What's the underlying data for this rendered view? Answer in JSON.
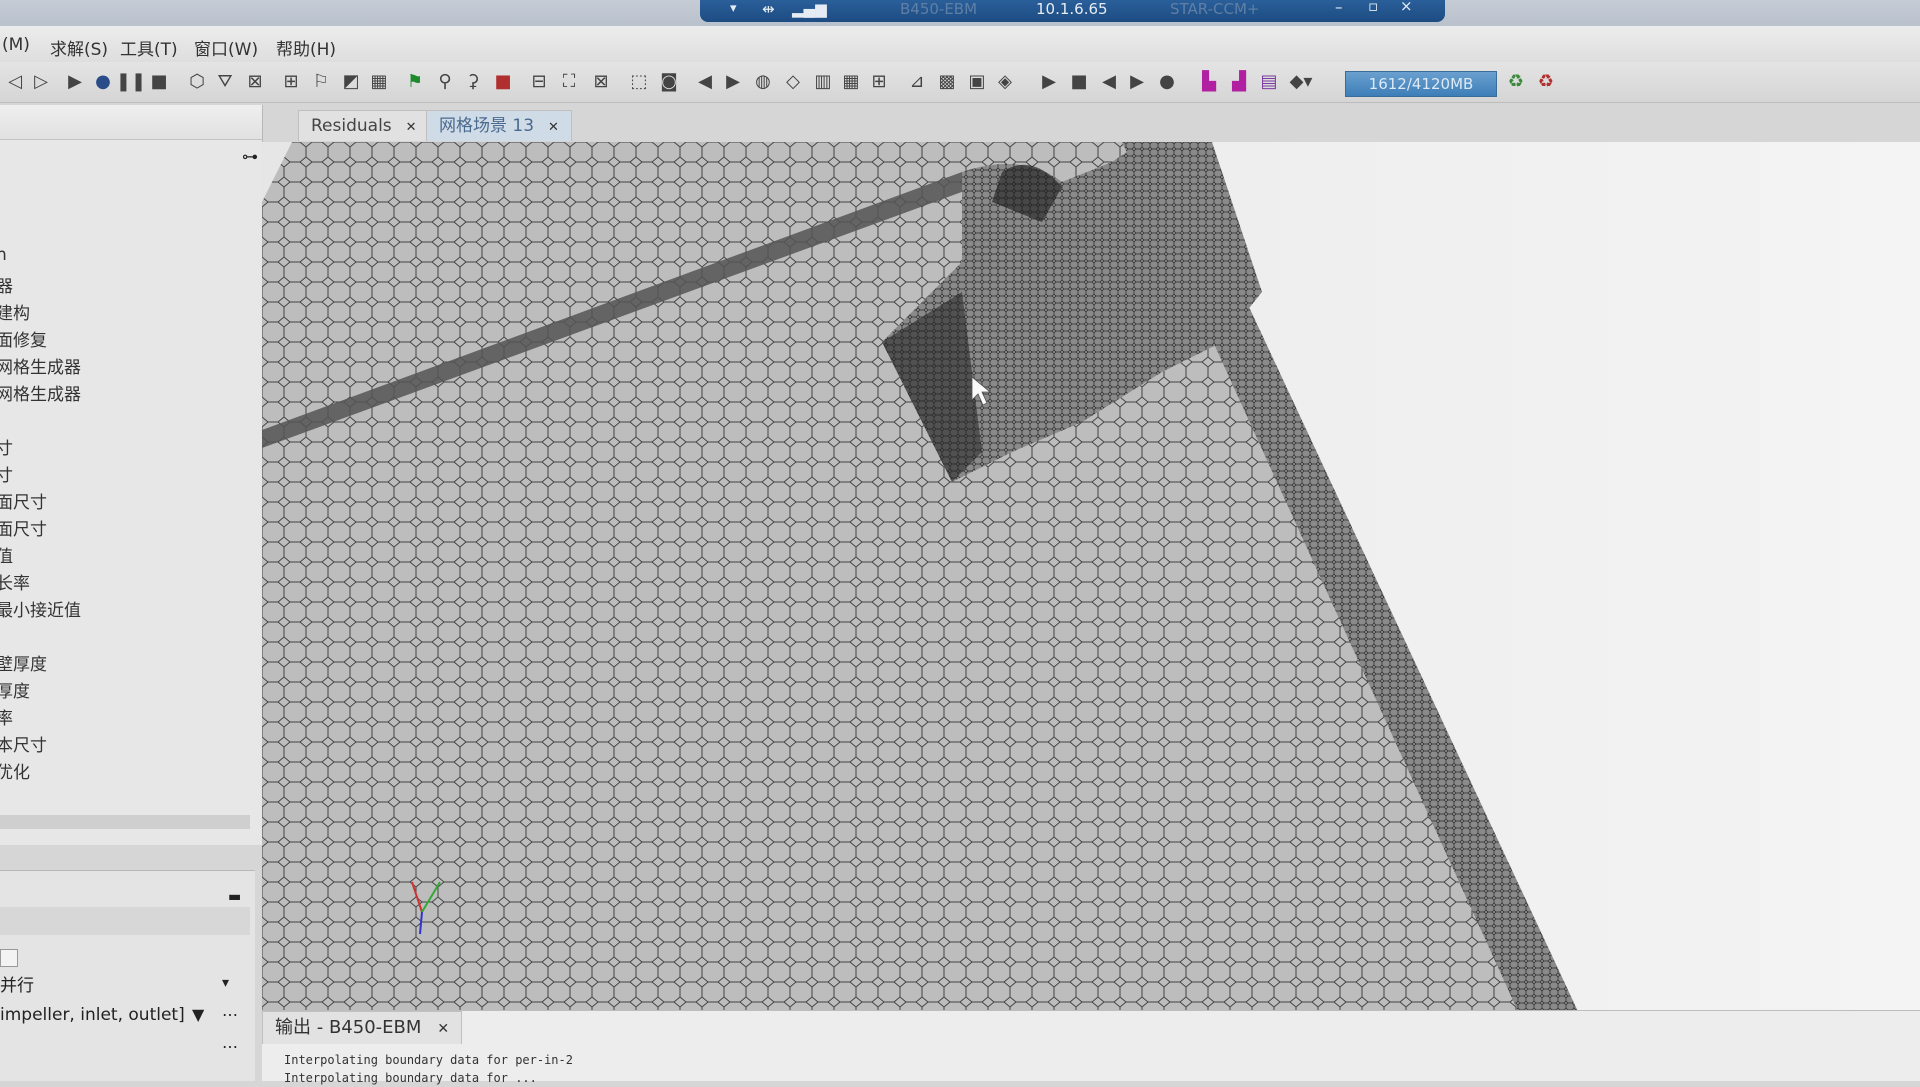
{
  "titlebar": {
    "version": "10.1.6.65",
    "doc_ghost": "B450-EBM",
    "run_ghost": "STAR-CCM+"
  },
  "menu": [
    "(M)",
    "求解(S)",
    "工具(T)",
    "窗口(W)",
    "帮助(H)"
  ],
  "toolbar": {
    "memory": "1612/4120MB"
  },
  "tabs": [
    {
      "label": "Residuals",
      "active": false
    },
    {
      "label": "网格场景 13",
      "active": true
    }
  ],
  "tree": [
    "h",
    "器",
    "建构",
    "面修复",
    "网格生成器",
    "网格生成器",
    "寸",
    "寸",
    "面尺寸",
    "面尺寸",
    "值",
    "长率",
    "最小接近值",
    "壁厚度",
    "厚度",
    "率",
    "本尺寸",
    "优化"
  ],
  "lower_panel": {
    "row1": "并行",
    "filter": "impeller, inlet, outlet]"
  },
  "output": {
    "tab_label": "输出 - B450-EBM",
    "lines": [
      "Interpolating  boundary data for per-in-2",
      "Interpolating  boundary data for ..."
    ]
  },
  "colors": {
    "titlebar_blue": "#1d4c82",
    "mesh_bg": "#b9b9b9",
    "mesh_line": "#3a3a3a",
    "memory_bar": "#3d7eb8"
  }
}
